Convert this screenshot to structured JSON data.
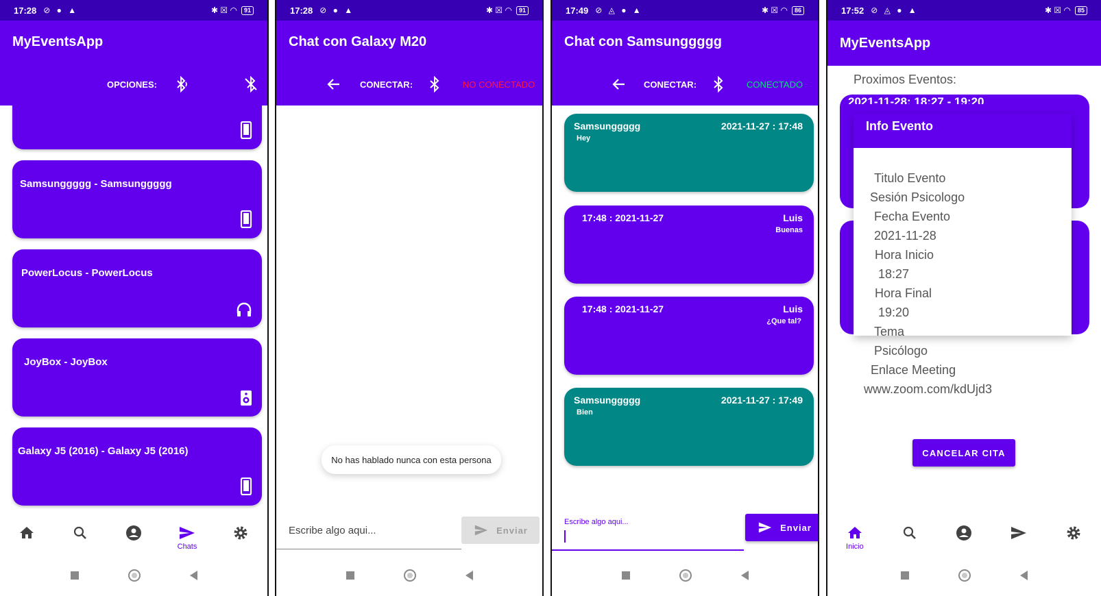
{
  "status": {
    "p1": {
      "time": "17:28",
      "battery": "91"
    },
    "p2": {
      "time": "17:28",
      "battery": "91"
    },
    "p3": {
      "time": "17:49",
      "battery": "86"
    },
    "p4": {
      "time": "17:52",
      "battery": "85"
    }
  },
  "screen1": {
    "title": "MyEventsApp",
    "options_label": "OPCIONES:",
    "devices": [
      {
        "name": "",
        "icon": "smartphone-icon"
      },
      {
        "name": "Samsunggggg - Samsunggggg",
        "icon": "smartphone-icon"
      },
      {
        "name": "PowerLocus - PowerLocus",
        "icon": "headphones-icon"
      },
      {
        "name": "JoyBox - JoyBox",
        "icon": "speaker-icon"
      },
      {
        "name": "Galaxy J5 (2016) - Galaxy J5 (2016)",
        "icon": "smartphone-icon"
      }
    ],
    "nav": {
      "chats_label": "Chats"
    }
  },
  "screen2": {
    "title": "Chat con Galaxy M20",
    "connect_label": "CONECTAR:",
    "status": "NO CONECTADO",
    "status_color": "#ff1744",
    "toast": "No has hablado nunca con esta persona",
    "input_placeholder": "Escribe algo aqui...",
    "send_label": "Enviar"
  },
  "screen3": {
    "title": "Chat con Samsunggggg",
    "connect_label": "CONECTAR:",
    "status": "CONECTADO",
    "status_color": "#00e676",
    "messages": [
      {
        "sender": "Samsunggggg",
        "stamp": "2021-11-27 : 17:48",
        "text": "Hey",
        "side": "left"
      },
      {
        "sender": "Luis",
        "stamp": "17:48 : 2021-11-27",
        "text": "Buenas",
        "side": "right"
      },
      {
        "sender": "Luis",
        "stamp": "17:48 : 2021-11-27",
        "text": "¿Que tal?",
        "side": "right"
      },
      {
        "sender": "Samsunggggg",
        "stamp": "2021-11-27 : 17:49",
        "text": "Bien",
        "side": "left"
      }
    ],
    "input_label": "Escribe algo aqui...",
    "send_label": "Enviar"
  },
  "screen4": {
    "title": "MyEventsApp",
    "upcoming_label": "Proximos Eventos:",
    "card_header": "2021-11-28: 18:27 - 19:20",
    "dialog_title": "Info Evento",
    "fields": {
      "titulo_label": "Titulo Evento",
      "titulo_value": "Sesión Psicologo",
      "fecha_label": "Fecha Evento",
      "fecha_value": "2021-11-28",
      "inicio_label": "Hora Inicio",
      "inicio_value": "18:27",
      "final_label": "Hora Final",
      "final_value": "19:20",
      "tema_label": "Tema",
      "tema_value": "Psicólogo",
      "enlace_label": "Enlace Meeting",
      "enlace_value": "www.zoom.com/kdUjd3"
    },
    "cancel_label": "CANCELAR CITA",
    "nav": {
      "home_label": "Inicio"
    }
  },
  "colors": {
    "primary": "#6200ee",
    "primary_dark": "#3700b3",
    "teal": "#018786"
  }
}
